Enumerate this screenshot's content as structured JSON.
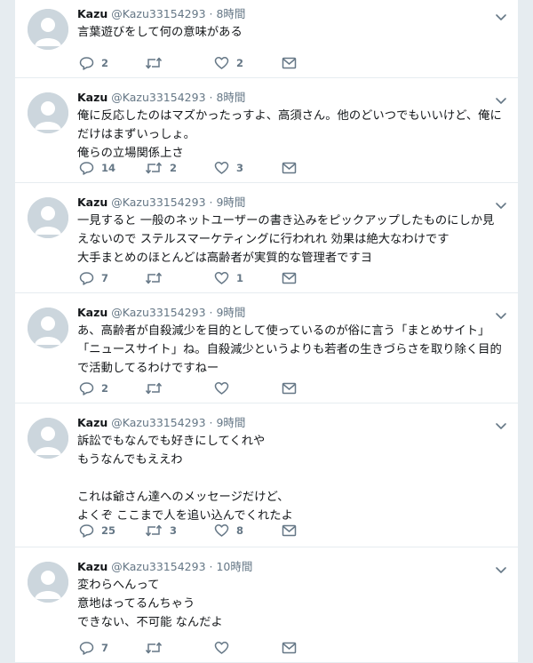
{
  "colors": {
    "background": "#e6ecf0",
    "card": "#ffffff",
    "text": "#14171a",
    "muted": "#657786",
    "avatar": "#ccd6dd"
  },
  "tweets": [
    {
      "name": "Kazu",
      "handle": "@Kazu33154293",
      "dot": "·",
      "time": "8時間",
      "text": "言葉遊びをして何の意味がある",
      "reply_count": "2",
      "retweet_count": "",
      "like_count": "2"
    },
    {
      "name": "Kazu",
      "handle": "@Kazu33154293",
      "dot": "·",
      "time": "8時間",
      "text": "俺に反応したのはマズかったっすよ、高須さん。他のどいつでもいいけど、俺に\nだけはまずいっしょ。\n俺らの立場関係上さ",
      "reply_count": "14",
      "retweet_count": "2",
      "like_count": "3"
    },
    {
      "name": "Kazu",
      "handle": "@Kazu33154293",
      "dot": "·",
      "time": "9時間",
      "text": "一見すると 一般のネットユーザーの書き込みをピックアップしたものにしか見\nえないので ステルスマーケティングに行われれ 効果は絶大なわけです\n大手まとめのほとんどは高齢者が実質的な管理者ですヨ",
      "reply_count": "7",
      "retweet_count": "",
      "like_count": "1"
    },
    {
      "name": "Kazu",
      "handle": "@Kazu33154293",
      "dot": "·",
      "time": "9時間",
      "text": "あ、高齢者が自殺減少を目的として使っているのが俗に言う「まとめサイト」\n「ニュースサイト」ね。自殺減少というよりも若者の生きづらさを取り除く目的\nで活動してるわけですねー",
      "reply_count": "2",
      "retweet_count": "",
      "like_count": ""
    },
    {
      "name": "Kazu",
      "handle": "@Kazu33154293",
      "dot": "·",
      "time": "9時間",
      "text": "訴訟でもなんでも好きにしてくれや\nもうなんでもええわ\n\nこれは爺さん達へのメッセージだけど、\nよくぞ ここまで人を追い込んでくれたよ",
      "reply_count": "25",
      "retweet_count": "3",
      "like_count": "8"
    },
    {
      "name": "Kazu",
      "handle": "@Kazu33154293",
      "dot": "·",
      "time": "10時間",
      "text": "変わらへんって\n意地はってるんちゃう\nできない、不可能 なんだよ",
      "reply_count": "7",
      "retweet_count": "",
      "like_count": ""
    }
  ],
  "icons": {
    "avatar": "default-profile-icon",
    "caret": "chevron-down-icon",
    "reply": "reply-icon",
    "retweet": "retweet-icon",
    "like": "heart-icon",
    "dm": "envelope-icon"
  }
}
